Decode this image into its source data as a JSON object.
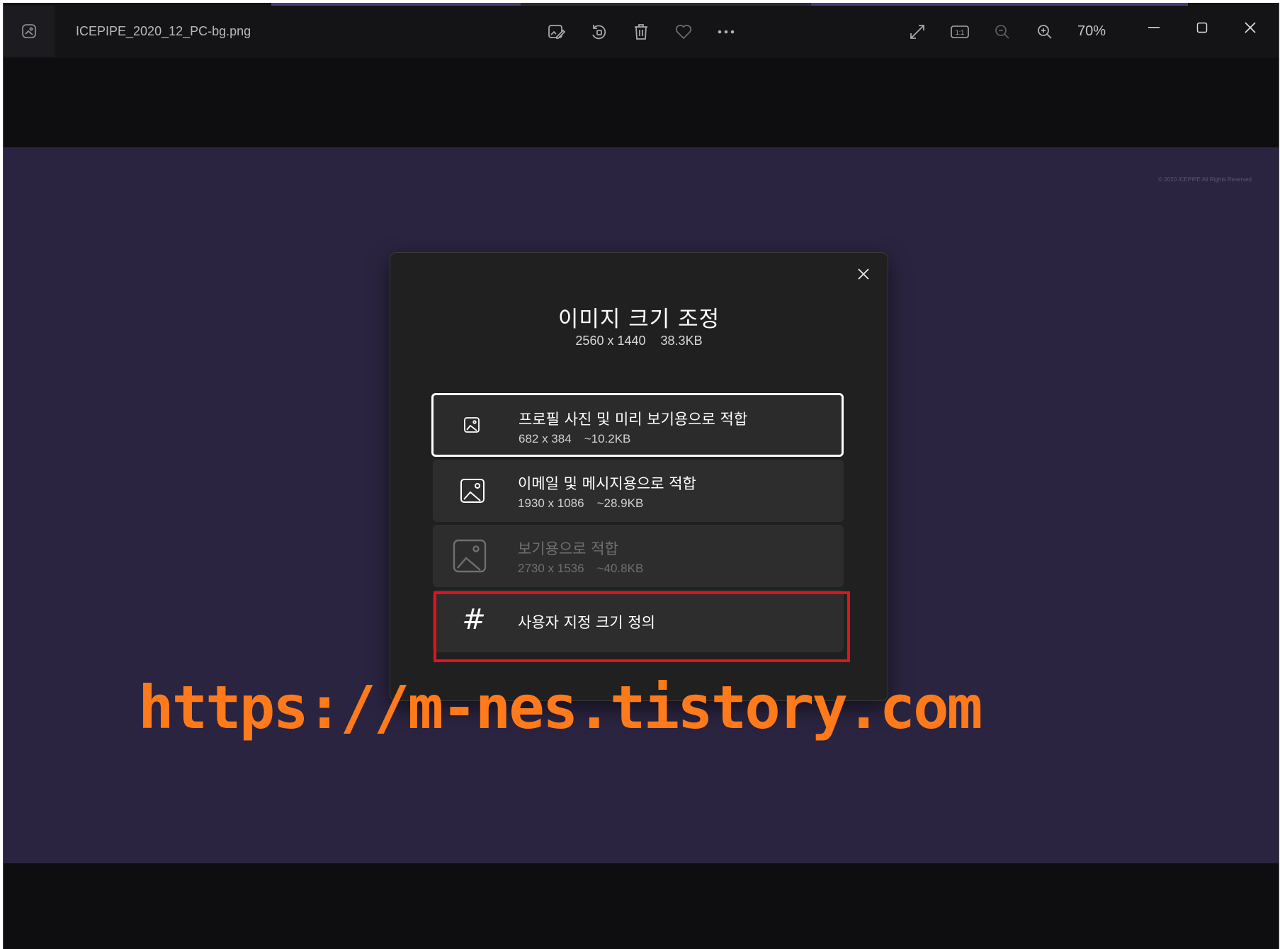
{
  "window": {
    "filename": "ICEPIPE_2020_12_PC-bg.png",
    "zoom": "70%",
    "copyright": "© 2020 ICEPIPE All Rights Reserved"
  },
  "toolbar": {
    "icons": [
      "edit-image-icon",
      "rotate-icon",
      "delete-icon",
      "favorite-heart-icon",
      "more-options-icon"
    ],
    "right_icons": [
      "fullscreen-icon",
      "actual-size-icon",
      "zoom-out-icon",
      "zoom-in-icon"
    ],
    "actual_size_label": "1:1"
  },
  "dialog": {
    "title": "이미지 크기 조정",
    "dimensions": "2560 x 1440",
    "size": "38.3KB",
    "options": [
      {
        "title": "프로필 사진 및 미리 보기용으로 적합",
        "dimensions": "682 x 384",
        "size": "~10.2KB",
        "icon": "small-image-icon"
      },
      {
        "title": "이메일 및 메시지용으로 적합",
        "dimensions": "1930 x 1086",
        "size": "~28.9KB",
        "icon": "medium-image-icon"
      },
      {
        "title": "보기용으로 적합",
        "dimensions": "2730 x 1536",
        "size": "~40.8KB",
        "icon": "large-image-icon"
      },
      {
        "title": "사용자 지정 크기 정의",
        "icon": "hash-icon",
        "glyph": "#"
      }
    ]
  },
  "watermark": "https://m-nes.tistory.com",
  "colors": {
    "image_bg": "#2b2440",
    "highlight": "#e0141e",
    "watermark": "#ff7a1a"
  }
}
